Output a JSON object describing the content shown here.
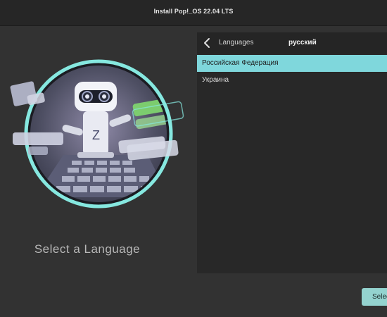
{
  "window": {
    "title": "Install Pop!_OS 22.04 LTS"
  },
  "main": {
    "title": "Select a Language"
  },
  "panel": {
    "back_label": "Languages",
    "current_language": "русский",
    "items": [
      {
        "label": "Российская Федерация",
        "selected": true
      },
      {
        "label": "Украина",
        "selected": false
      }
    ]
  },
  "footer": {
    "select_label": "Select"
  },
  "colors": {
    "accent": "#7fd7dc",
    "button": "#94d3cf",
    "background": "#323232",
    "panel": "#282828"
  },
  "icons": {
    "back": "chevron-left-icon"
  }
}
